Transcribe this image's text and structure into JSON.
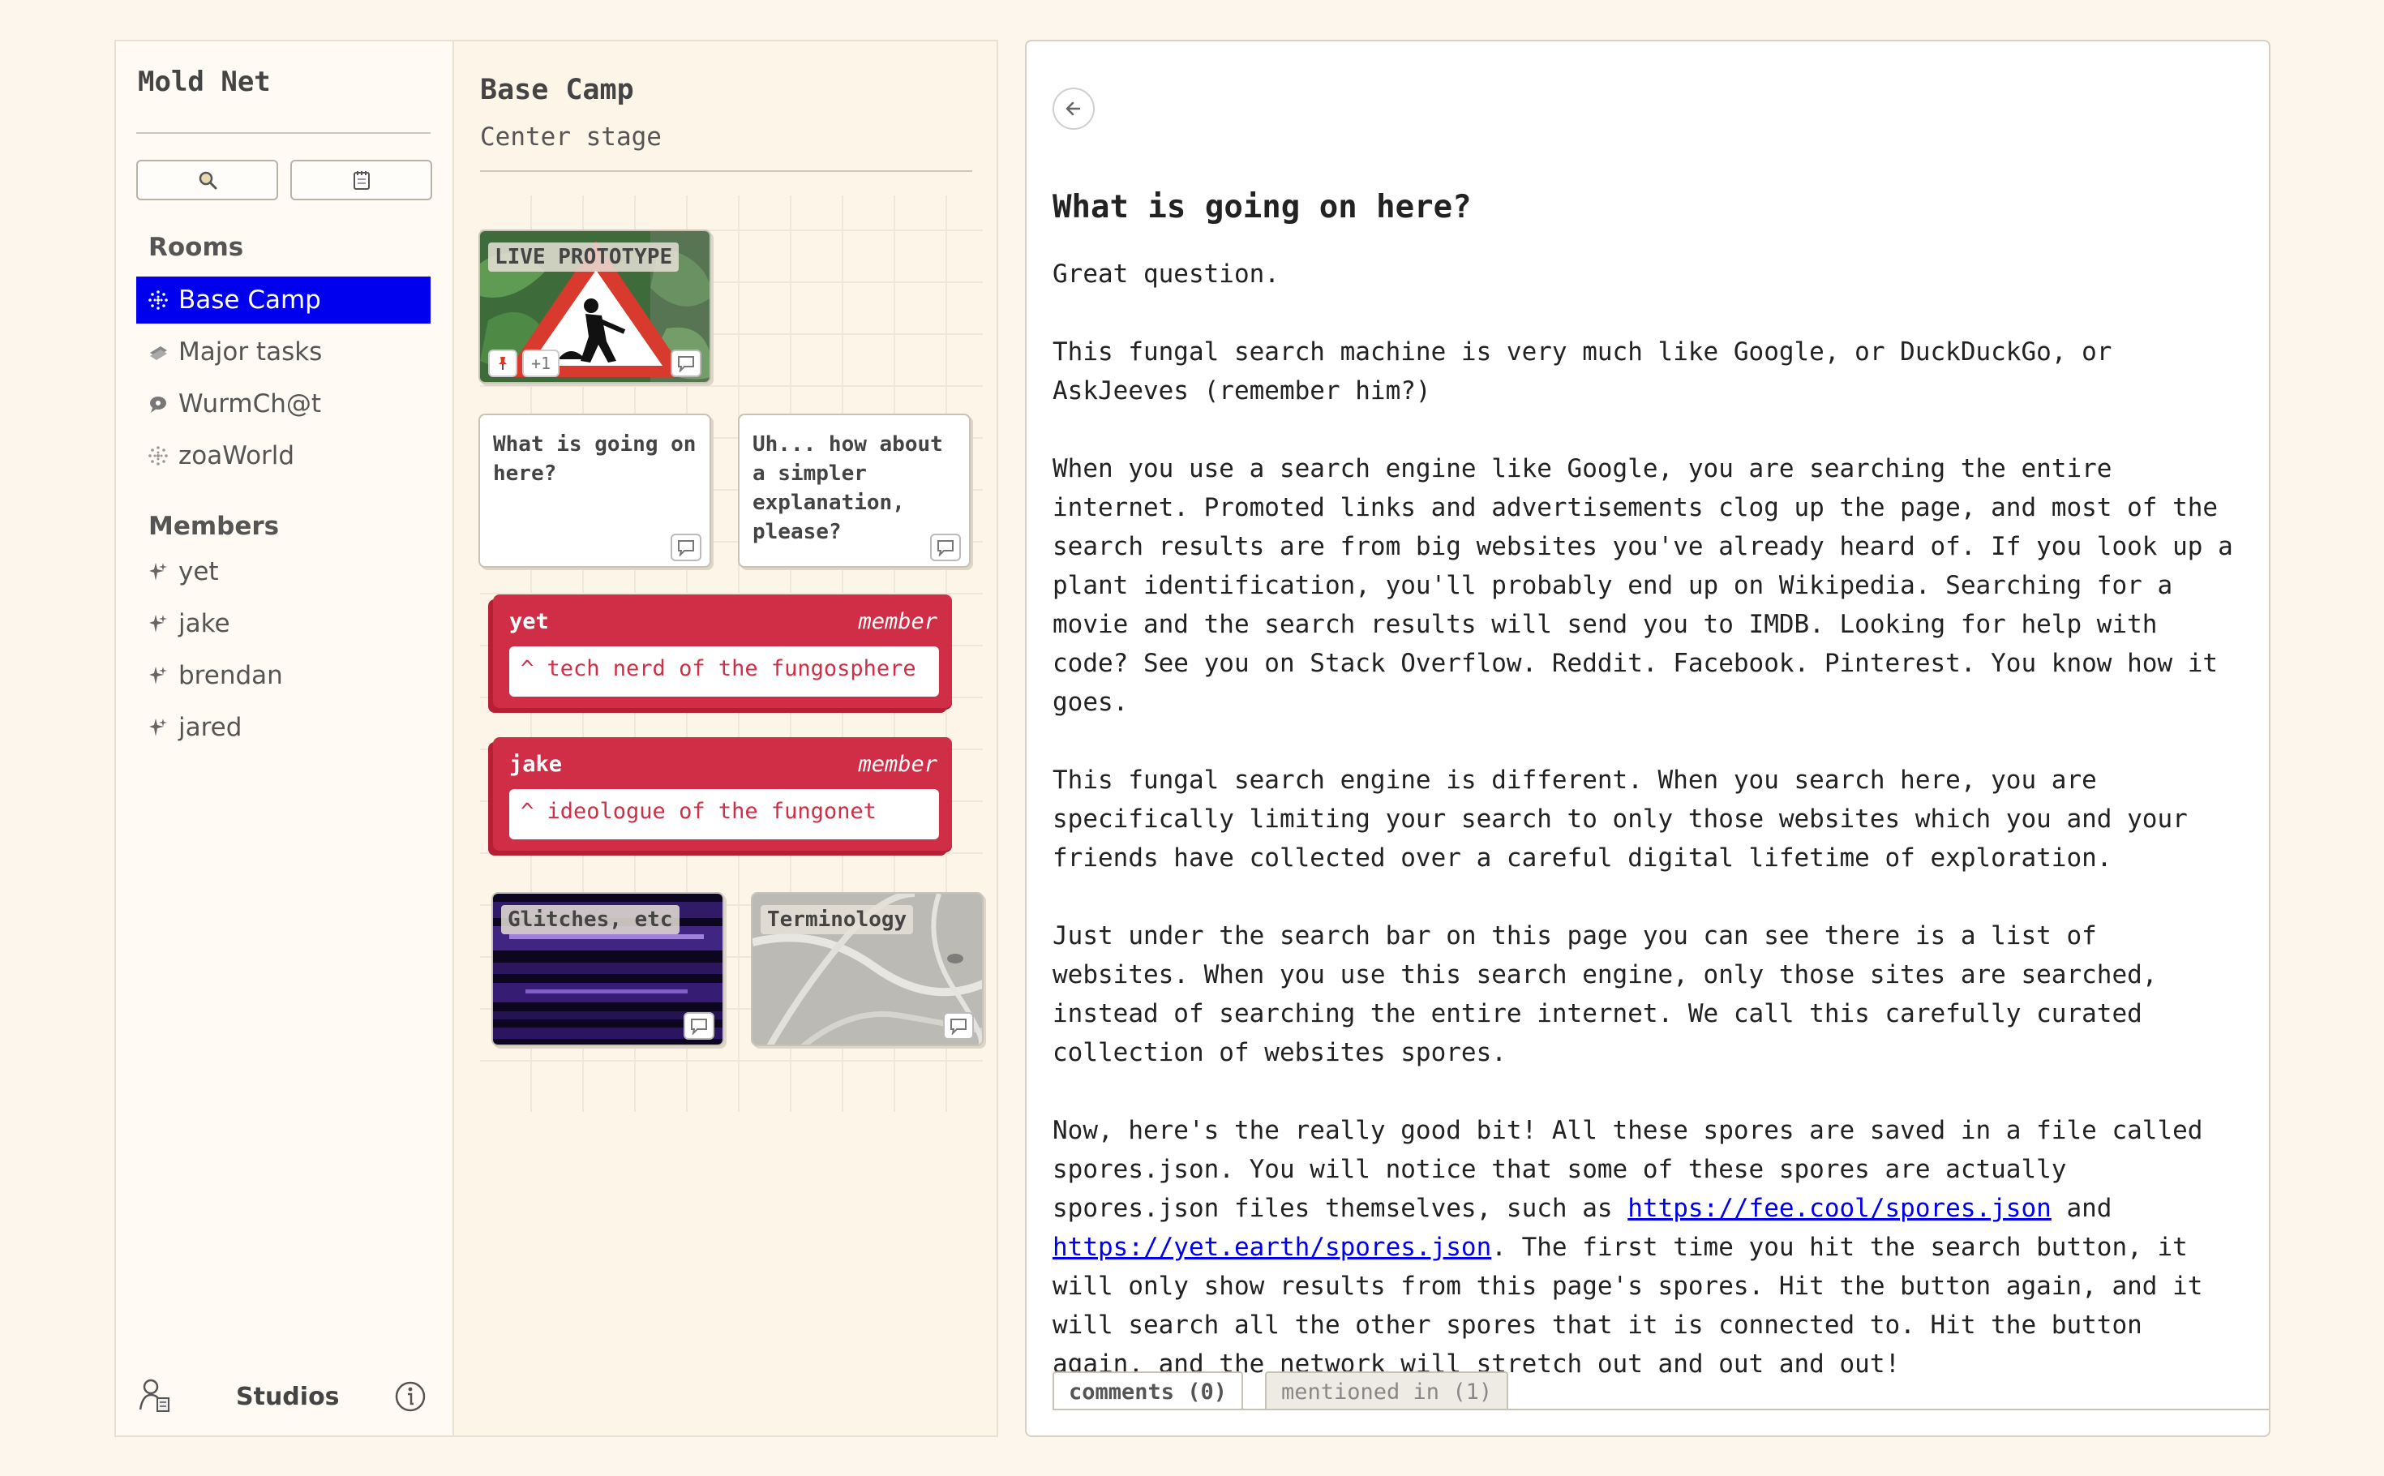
{
  "app": {
    "title": "Mold Net"
  },
  "sidebar": {
    "rooms_heading": "Rooms",
    "rooms": [
      {
        "label": "Base Camp",
        "icon": "grid-dots-icon",
        "active": true
      },
      {
        "label": "Major tasks",
        "icon": "stack-icon"
      },
      {
        "label": "WurmCh@t",
        "icon": "chat-icon"
      },
      {
        "label": "zoaWorld",
        "icon": "grid-dots-icon"
      }
    ],
    "members_heading": "Members",
    "members": [
      {
        "label": "yet",
        "icon": "sparkle-icon"
      },
      {
        "label": "jake",
        "icon": "sparkle-icon"
      },
      {
        "label": "brendan",
        "icon": "sparkle-icon"
      },
      {
        "label": "jared",
        "icon": "sparkle-icon"
      }
    ],
    "footer_label": "Studios"
  },
  "board": {
    "title": "Base Camp",
    "subtitle": "Center stage",
    "cards": {
      "live_prototype": {
        "label": "LIVE PROTOTYPE",
        "extra": "+1"
      },
      "question": "What is going on here?",
      "simpler": "Uh... how about a simpler explanation, please?",
      "glitches": "Glitches, etc",
      "terminology": "Terminology"
    },
    "members": [
      {
        "name": "yet",
        "role": "member",
        "desc": "^ tech nerd of the fungosphere"
      },
      {
        "name": "jake",
        "role": "member",
        "desc": "^ ideologue of the fungonet"
      }
    ]
  },
  "doc": {
    "title": "What is going on here?",
    "paragraphs": {
      "p1": "Great question.",
      "p2": "This fungal search machine is very much like Google, or DuckDuckGo, or AskJeeves (remember him?)",
      "p3": "When you use a search engine like Google, you are searching the entire internet. Promoted links and advertisements clog up the page, and most of the search results are from big websites you've already heard of. If you look up a plant identification, you'll probably end up on Wikipedia. Searching for a movie and the search results will send you to IMDB. Looking for help with code? See you on Stack Overflow. Reddit. Facebook. Pinterest. You know how it goes.",
      "p4": "This fungal search engine is different. When you search here, you are specifically limiting your search to only those websites which you and your friends have collected over a careful digital lifetime of exploration.",
      "p5": "Just under the search bar on this page you can see there is a list of websites. When you use this search engine, only those sites are searched, instead of searching the entire internet. We call this carefully curated collection of websites spores.",
      "p6a": "Now, here's the really good bit! All these spores are saved in a file called spores.json. You will notice that some of these spores are actually spores.json files themselves, such as ",
      "link1": "https://fee.cool/spores.json",
      "p6b": " and ",
      "link2": "https://yet.earth/spores.json",
      "p6c": ". The first time you hit the search button, it will only show results from this page's spores. Hit the button again, and it will search all the other spores that it is connected to. Hit the button again, and the network will stretch out and out and out!"
    },
    "tabs": {
      "comments": "comments (0)",
      "mentioned": "mentioned in (1)"
    }
  },
  "colors": {
    "accent_blue": "#0000ee",
    "member_red": "#cf2e46",
    "background": "#fdf6ec"
  }
}
